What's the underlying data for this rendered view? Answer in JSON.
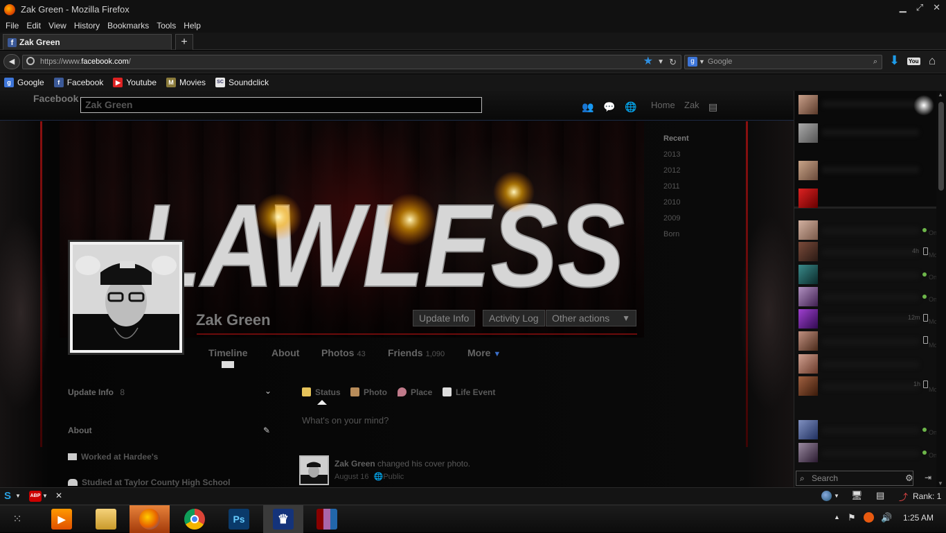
{
  "window": {
    "title": "Zak Green - Mozilla Firefox"
  },
  "menu": [
    "File",
    "Edit",
    "View",
    "History",
    "Bookmarks",
    "Tools",
    "Help"
  ],
  "tab": {
    "label": "Zak Green",
    "new_tab": "+"
  },
  "url": {
    "prefix": "https://www.",
    "host": "facebook.com",
    "suffix": "/"
  },
  "search": {
    "placeholder": "Google"
  },
  "bookmarks": [
    {
      "label": "Google",
      "color": "#3d75d8",
      "glyph": "g"
    },
    {
      "label": "Facebook",
      "color": "#3b5998",
      "glyph": "f"
    },
    {
      "label": "Youtube",
      "color": "#d22",
      "glyph": "▶"
    },
    {
      "label": "Movies",
      "color": "#8a7a3a",
      "glyph": "M"
    },
    {
      "label": "Soundclick",
      "color": "#e8e8e8",
      "glyph": "SC"
    }
  ],
  "fb": {
    "logo": "Facebook",
    "search_value": "Zak Green",
    "nav_home": "Home",
    "nav_user": "Zak",
    "cover_text": "LAWLESS",
    "profile_name": "Zak Green",
    "buttons": {
      "update_info": "Update Info",
      "activity_log": "Activity Log",
      "other_actions": "Other actions"
    },
    "tabs": {
      "timeline": "Timeline",
      "about": "About",
      "photos": "Photos",
      "photos_count": "43",
      "friends": "Friends",
      "friends_count": "1,090",
      "more": "More"
    },
    "timeline_years": [
      "Recent",
      "2013",
      "2012",
      "2011",
      "2010",
      "2009",
      "Born"
    ],
    "left": {
      "update_info": "Update Info",
      "update_count": "8",
      "about": "About",
      "worked": "Worked at Hardee's",
      "studied": "Studied at Taylor County High School"
    },
    "composer": {
      "status": "Status",
      "photo": "Photo",
      "place": "Place",
      "life_event": "Life Event",
      "placeholder": "What's on your mind?"
    },
    "post": {
      "name": "Zak Green",
      "action": " changed his cover photo.",
      "date": "August 16",
      "privacy": "Public"
    }
  },
  "chat": {
    "search_placeholder": "Search",
    "times": [
      "4h",
      "12m",
      "1h"
    ],
    "status_online": "Online",
    "status_mobile": "Mobile"
  },
  "addon": {
    "rank": "Rank: 1"
  },
  "tray": {
    "time": "1:25 AM"
  },
  "colors": {
    "fb_blue": "#3b5998",
    "online": "#6db64a",
    "firefox_orange": "#e66000"
  }
}
